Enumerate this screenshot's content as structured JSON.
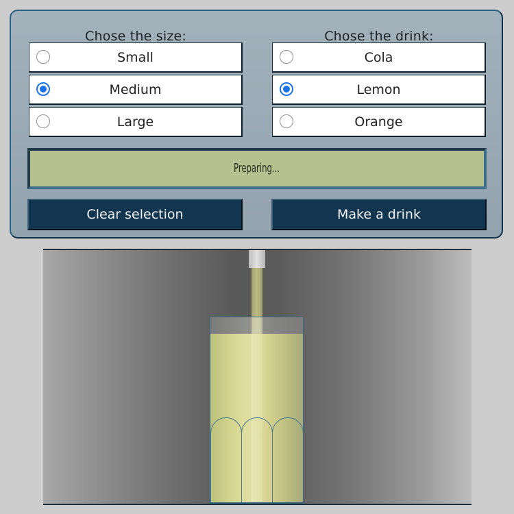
{
  "size_group": {
    "heading": "Chose the size:",
    "options": [
      {
        "label": "Small",
        "selected": false
      },
      {
        "label": "Medium",
        "selected": true
      },
      {
        "label": "Large",
        "selected": false
      }
    ]
  },
  "drink_group": {
    "heading": "Chose the drink:",
    "options": [
      {
        "label": "Cola",
        "selected": false
      },
      {
        "label": "Lemon",
        "selected": true
      },
      {
        "label": "Orange",
        "selected": false
      }
    ]
  },
  "status": {
    "text": "Preparing..."
  },
  "buttons": {
    "clear_label": "Clear selection",
    "make_label": "Make a drink"
  },
  "colors": {
    "accent": "#1a73e8",
    "button_bg": "#123650",
    "status_bg": "#b7c08f",
    "liquid": "#d4d58f"
  },
  "scene": {
    "glass_fill_fraction": 0.91
  }
}
